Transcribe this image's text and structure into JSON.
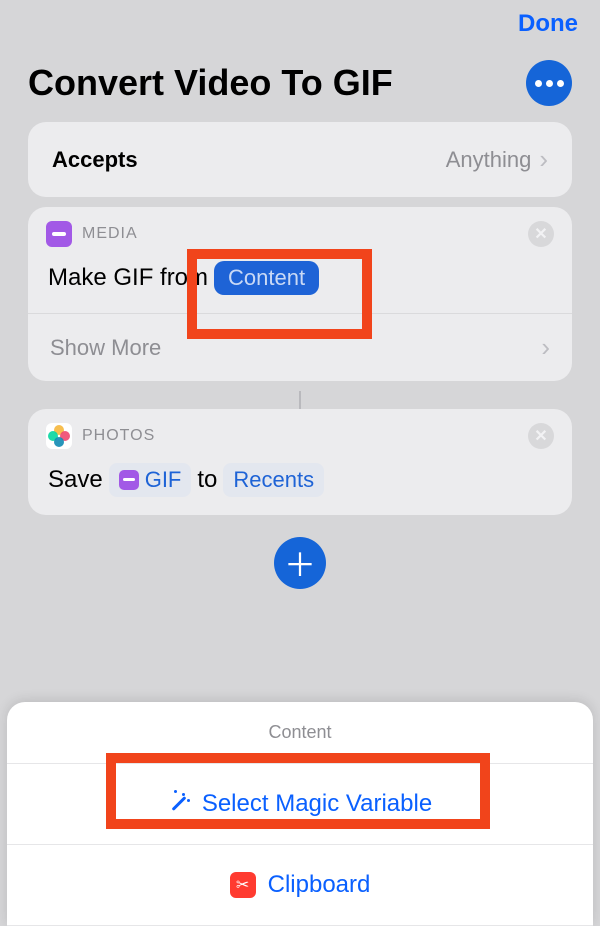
{
  "topbar": {
    "done": "Done"
  },
  "title": "Convert Video To GIF",
  "accepts": {
    "label": "Accepts",
    "value": "Anything"
  },
  "action_media": {
    "category": "MEDIA",
    "text_prefix": "Make GIF from",
    "content_pill": "Content",
    "show_more": "Show More"
  },
  "action_photos": {
    "category": "PHOTOS",
    "text_save": "Save",
    "gif_pill": "GIF",
    "text_to": "to",
    "recents_pill": "Recents"
  },
  "sheet": {
    "title": "Content",
    "magic_variable": "Select Magic Variable",
    "clipboard": "Clipboard"
  }
}
